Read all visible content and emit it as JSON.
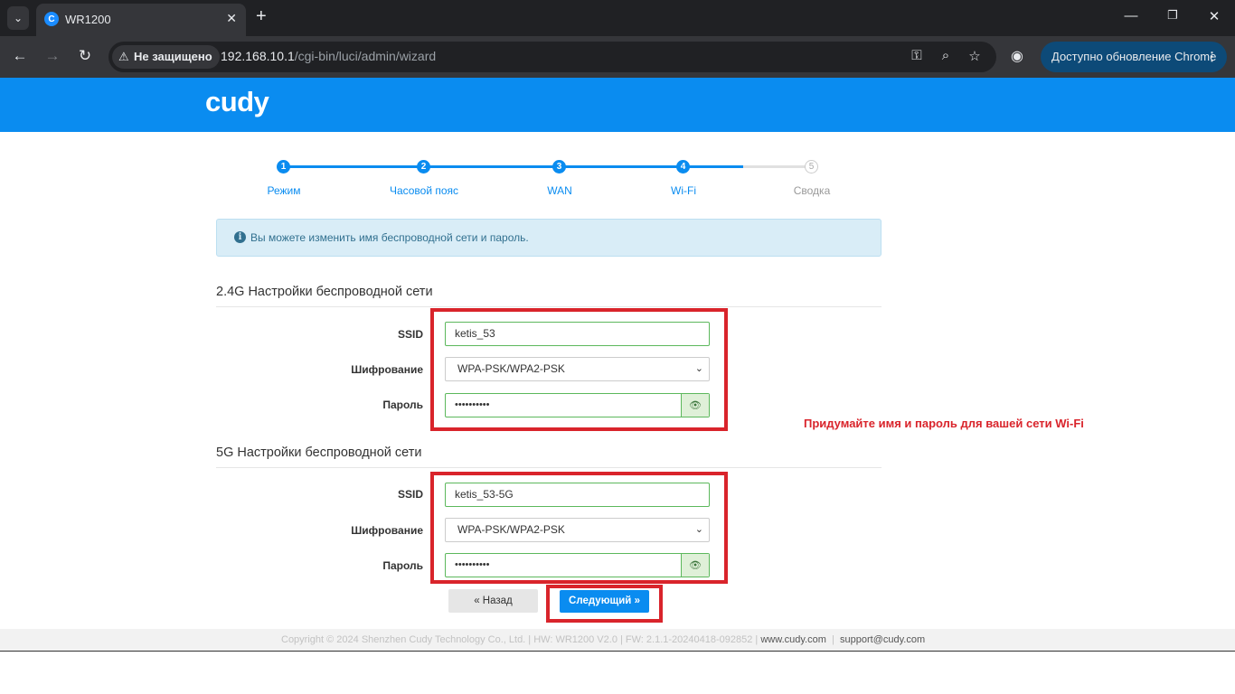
{
  "browser": {
    "tab_title": "WR1200",
    "tab_favicon": "C",
    "security_label": "Не защищено",
    "url_host": "192.168.10.1",
    "url_path": "/cgi-bin/luci/admin/wizard",
    "update_label": "Доступно обновление Chrome"
  },
  "header": {
    "logo": "cudy"
  },
  "steps": [
    {
      "num": "1",
      "label": "Режим",
      "active": true
    },
    {
      "num": "2",
      "label": "Часовой пояс",
      "active": true
    },
    {
      "num": "3",
      "label": "WAN",
      "active": true
    },
    {
      "num": "4",
      "label": "Wi-Fi",
      "active": true
    },
    {
      "num": "5",
      "label": "Сводка",
      "active": false
    }
  ],
  "alert": {
    "icon": "i",
    "text": "Вы можете изменить имя беспроводной сети и пароль."
  },
  "wifi24": {
    "title": "2.4G Настройки беспроводной сети",
    "ssid_label": "SSID",
    "ssid_value": "ketis_53",
    "enc_label": "Шифрование",
    "enc_value": "WPA-PSK/WPA2-PSK",
    "pwd_label": "Пароль",
    "pwd_value": "••••••••••"
  },
  "wifi5": {
    "title": "5G Настройки беспроводной сети",
    "ssid_label": "SSID",
    "ssid_value": "ketis_53-5G",
    "enc_label": "Шифрование",
    "enc_value": "WPA-PSK/WPA2-PSK",
    "pwd_label": "Пароль",
    "pwd_value": "••••••••••"
  },
  "hint": "Придумайте имя и пароль для вашей сети Wi-Fi",
  "buttons": {
    "back": "« Назад",
    "next": "Следующий »"
  },
  "footer": {
    "copyright": "Copyright © 2024 Shenzhen Cudy Technology Co., Ltd.  |  HW: WR1200 V2.0  |  FW: 2.1.1-20240418-092852  |",
    "site": "www.cudy.com",
    "sep": "|",
    "email": "support@cudy.com"
  },
  "colors": {
    "brand": "#0a8cf0",
    "annotation": "#d9242b",
    "valid": "#5cb85c"
  }
}
